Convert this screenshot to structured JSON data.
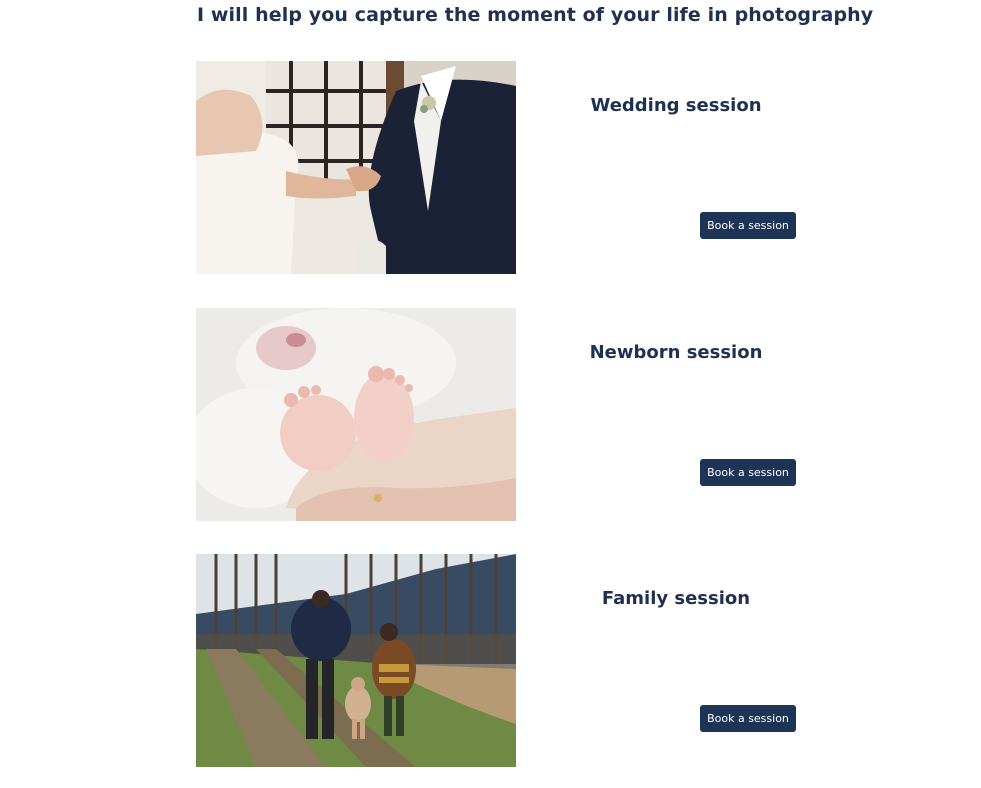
{
  "page": {
    "title": "I will help you capture the moment of your life in photography"
  },
  "sessions": [
    {
      "title": "Wedding session",
      "button_label": "Book a session",
      "photo_subject": "wedding-ring-exchange"
    },
    {
      "title": "Newborn session",
      "button_label": "Book a session",
      "photo_subject": "newborn-feet-in-hands"
    },
    {
      "title": "Family session",
      "button_label": "Book a session",
      "photo_subject": "family-walking-in-field"
    }
  ],
  "colors": {
    "heading": "#1f3150",
    "button_bg": "#1d3456",
    "button_text": "#ffffff",
    "page_bg": "#ffffff"
  }
}
